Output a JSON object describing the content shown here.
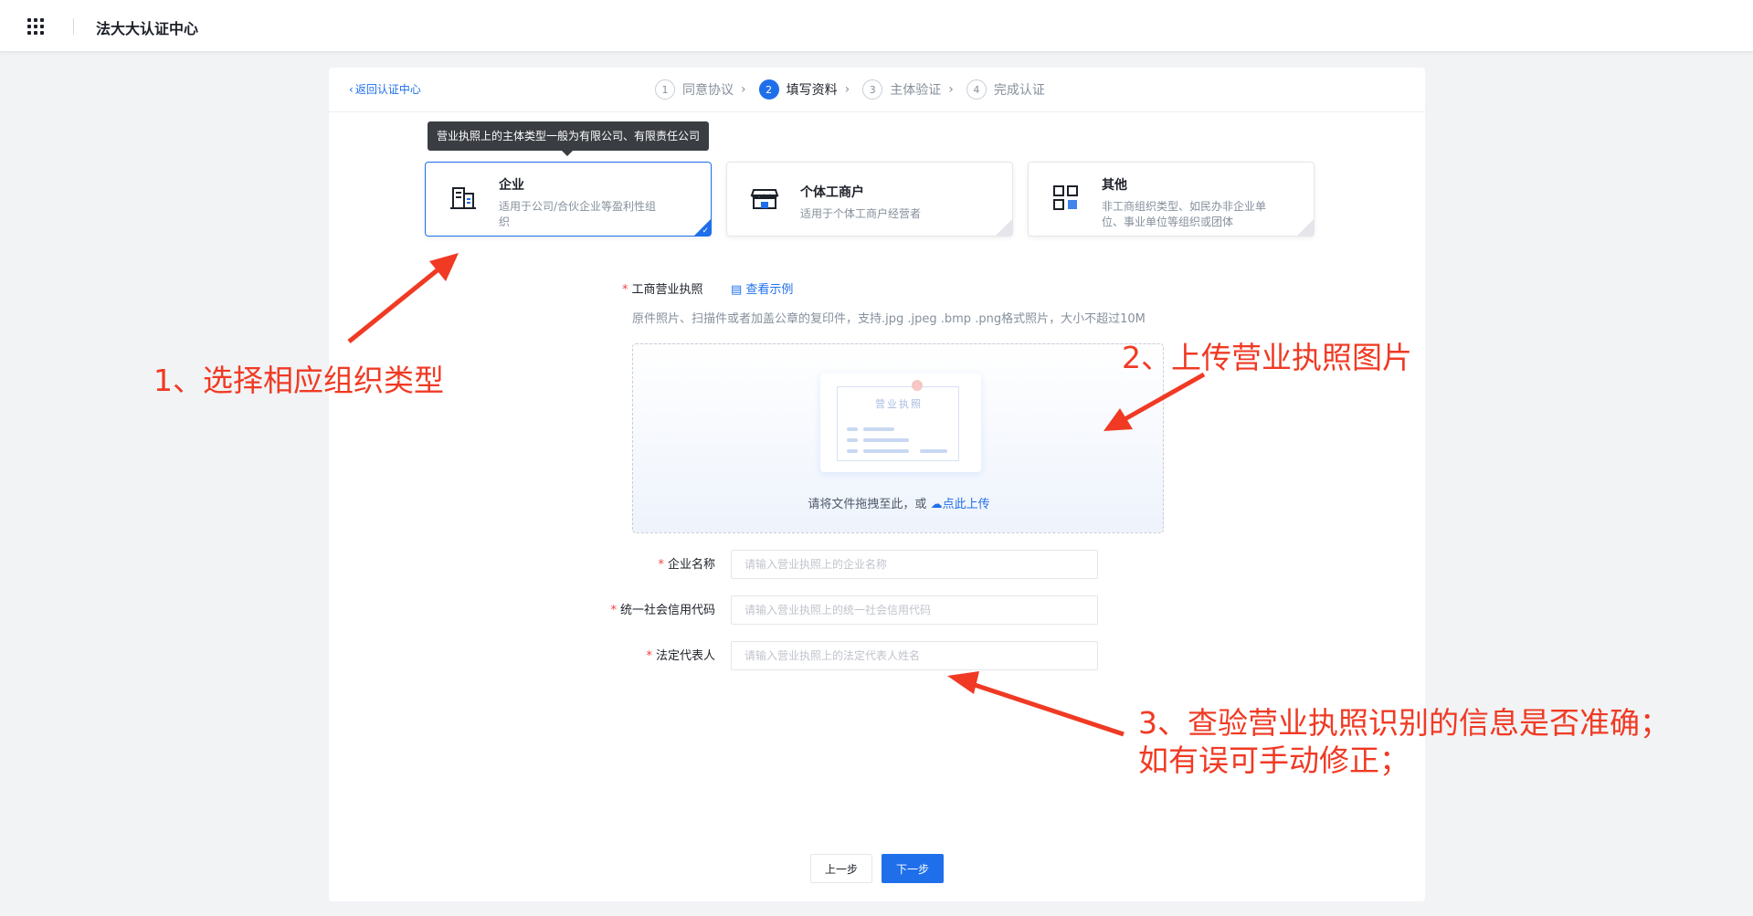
{
  "app": {
    "title": "法大大认证中心"
  },
  "header": {
    "back_label": "返回认证中心",
    "steps": [
      {
        "num": "1",
        "label": "同意协议"
      },
      {
        "num": "2",
        "label": "填写资料"
      },
      {
        "num": "3",
        "label": "主体验证"
      },
      {
        "num": "4",
        "label": "完成认证"
      }
    ],
    "active_step": 2
  },
  "tooltip": {
    "text": "营业执照上的主体类型一般为有限公司、有限责任公司"
  },
  "org_types": [
    {
      "title": "企业",
      "desc": "适用于公司/合伙企业等盈利性组织",
      "icon": "building-icon",
      "selected": true
    },
    {
      "title": "个体工商户",
      "desc": "适用于个体工商户经营者",
      "icon": "store-icon",
      "selected": false
    },
    {
      "title": "其他",
      "desc": "非工商组织类型、如民办非企业单位、事业单位等组织或团体",
      "icon": "grid-icon",
      "selected": false
    }
  ],
  "license": {
    "label": "工商营业执照",
    "example_link": "查看示例",
    "hint": "原件照片、扫描件或者加盖公章的复印件，支持.jpg .jpeg .bmp .png格式照片，大小不超过10M",
    "preview_title": "营业执照",
    "upload_prompt": "请将文件拖拽至此，或",
    "upload_link": "点此上传"
  },
  "fields": {
    "company_name": {
      "label": "企业名称",
      "placeholder": "请输入营业执照上的企业名称",
      "value": ""
    },
    "credit_code": {
      "label": "统一社会信用代码",
      "placeholder": "请输入营业执照上的统一社会信用代码",
      "value": ""
    },
    "legal_rep": {
      "label": "法定代表人",
      "placeholder": "请输入营业执照上的法定代表人姓名",
      "value": ""
    }
  },
  "buttons": {
    "prev": "上一步",
    "next": "下一步"
  },
  "annotations": {
    "a1": "1、选择相应组织类型",
    "a2": "2、上传营业执照图片",
    "a3_line1": "3、查验营业执照识别的信息是否准确；",
    "a3_line2": "如有误可手动修正；"
  },
  "colors": {
    "accent": "#1f6feb",
    "annotation": "#f03a24",
    "required": "#f53f3f"
  }
}
